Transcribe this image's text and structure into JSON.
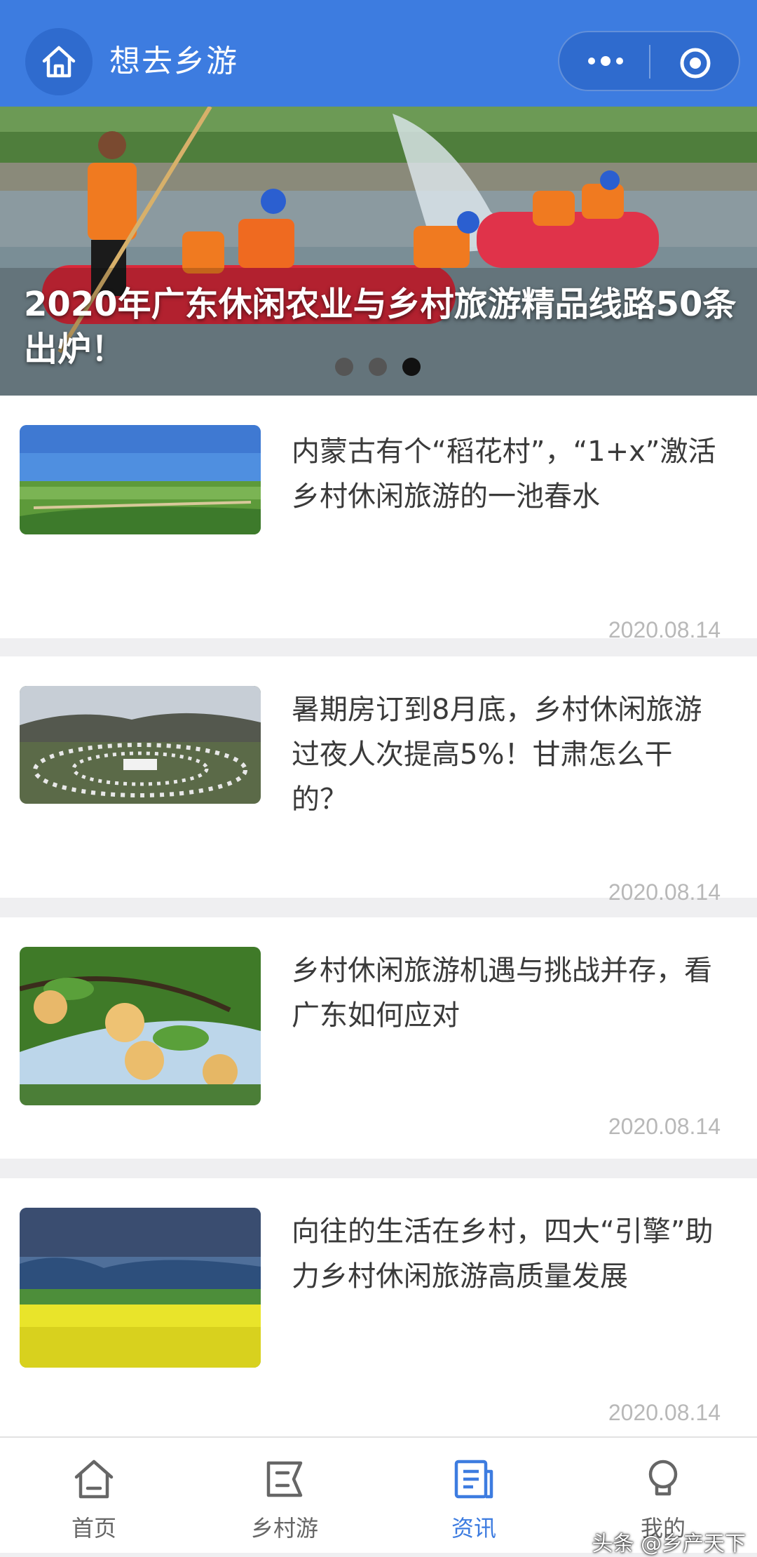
{
  "header": {
    "title": "想去乡游",
    "home_icon": "home-icon",
    "more_icon": "more-dots-icon",
    "target_icon": "target-icon"
  },
  "banner": {
    "title": "2020年广东休闲农业与乡村旅游精品线路50条出炉！",
    "slide_count": 3,
    "active_slide": 3
  },
  "articles": [
    {
      "title": "内蒙古有个“稻花村”，“1+x”激活乡村休闲旅游的一池春水",
      "date": "2020.08.14",
      "image": "grassland-farm"
    },
    {
      "title": "暑期房订到8月底，乡村休闲旅游过夜人次提高5%！甘肃怎么干的？",
      "date": "2020.08.14",
      "image": "yurt-camp"
    },
    {
      "title": "乡村休闲旅游机遇与挑战并存，看广东如何应对",
      "date": "2020.08.14",
      "image": "pear-tree"
    },
    {
      "title": "向往的生活在乡村，四大“引擎”助力乡村休闲旅游高质量发展",
      "date": "2020.08.14",
      "image": "rapeseed-field"
    }
  ],
  "tabbar": {
    "items": [
      {
        "label": "首页",
        "icon": "home-icon"
      },
      {
        "label": "乡村游",
        "icon": "map-flag-icon"
      },
      {
        "label": "资讯",
        "icon": "news-icon"
      },
      {
        "label": "我的",
        "icon": "profile-icon"
      }
    ],
    "active": 2
  },
  "watermark": "头条 @乡产天下",
  "colors": {
    "accent": "#3d7ce0",
    "header_dark": "#2f6bce",
    "date": "#b8b8b8"
  }
}
